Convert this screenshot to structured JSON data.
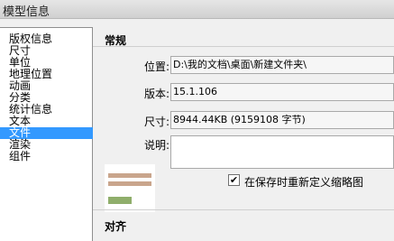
{
  "window": {
    "title": "模型信息"
  },
  "sidebar": {
    "items": [
      {
        "label": "版权信息"
      },
      {
        "label": "尺寸"
      },
      {
        "label": "单位"
      },
      {
        "label": "地理位置"
      },
      {
        "label": "动画"
      },
      {
        "label": "分类"
      },
      {
        "label": "统计信息"
      },
      {
        "label": "文本"
      },
      {
        "label": "文件",
        "selected": true
      },
      {
        "label": "渲染"
      },
      {
        "label": "组件"
      }
    ]
  },
  "general": {
    "title": "常规",
    "location_label": "位置:",
    "location_value": "D:\\我的文档\\桌面\\新建文件夹\\",
    "version_label": "版本:",
    "version_value": "15.1.106",
    "size_label": "尺寸:",
    "size_value": "8944.44KB (9159108 字节)",
    "description_label": "说明:",
    "redefine_thumbnail_label": "在保存时重新定义缩略图",
    "redefine_thumbnail_checked": true
  },
  "align": {
    "title": "对齐"
  },
  "colors": {
    "selection": "#3399ff"
  }
}
